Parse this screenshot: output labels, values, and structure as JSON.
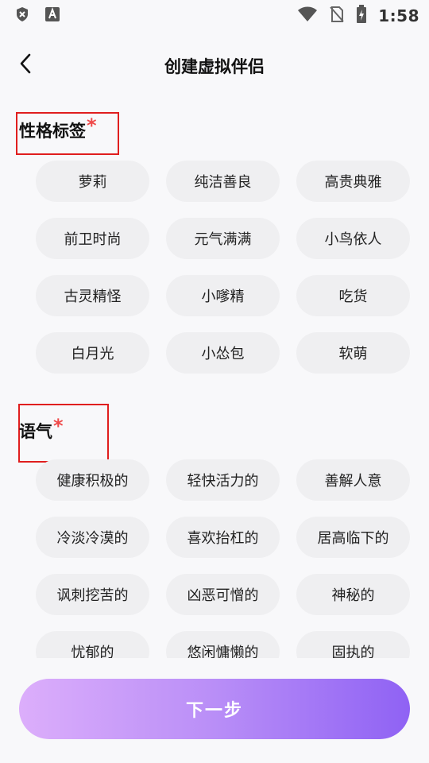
{
  "status_bar": {
    "time": "1:58",
    "icons": [
      "shield-x-icon",
      "text-format-icon",
      "wifi-icon",
      "no-sim-icon",
      "battery-charging-icon"
    ]
  },
  "header": {
    "title": "创建虚拟伴侣",
    "back_icon": "chevron-left-icon"
  },
  "personality": {
    "title": "性格标签",
    "required_mark": "*",
    "tags": [
      "萝莉",
      "纯洁善良",
      "高贵典雅",
      "前卫时尚",
      "元气满满",
      "小鸟依人",
      "古灵精怪",
      "小嗲精",
      "吃货",
      "白月光",
      "小怂包",
      "软萌"
    ]
  },
  "tone": {
    "title": "语气",
    "required_mark": "*",
    "tags": [
      "健康积极的",
      "轻快活力的",
      "善解人意",
      "冷淡冷漠的",
      "喜欢抬杠的",
      "居高临下的",
      "讽刺挖苦的",
      "凶恶可憎的",
      "神秘的",
      "忧郁的",
      "悠闲慵懒的",
      "固执的"
    ]
  },
  "next_button": {
    "label": "下一步"
  },
  "colors": {
    "accent_start": "#dcaefb",
    "accent_end": "#8f62f4",
    "required": "#ef4a4a",
    "highlight_box": "#e01e1e",
    "chip_bg": "#efeff1"
  }
}
